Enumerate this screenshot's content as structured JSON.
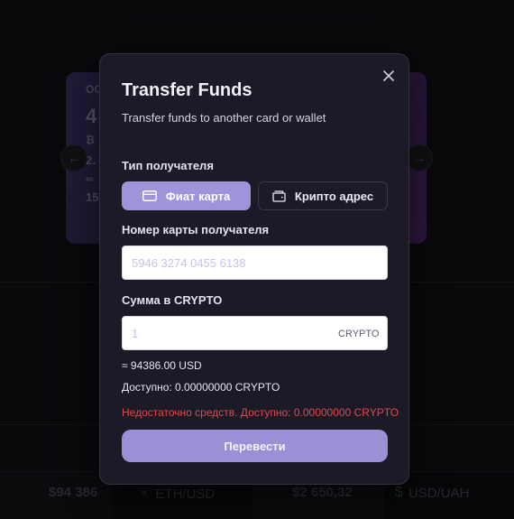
{
  "background": {
    "card": {
      "row1": "ОО",
      "row2": "4",
      "row3": "₿",
      "row4": "2.",
      "row5": "∞",
      "row6": "15"
    },
    "carousel": {
      "prev_icon": "arrow-left-icon",
      "next_icon": "arrow-right-icon"
    },
    "ticker": {
      "btc_price": "$94 386",
      "pair1_label": "ETH/USD",
      "pair1_icon": "eth-icon",
      "eth_price": "$2 650,32",
      "pair2_label": "USD/UAH",
      "pair2_icon": "dollar-icon"
    }
  },
  "modal": {
    "title": "Transfer Funds",
    "subtitle": "Transfer funds to another card or wallet",
    "close_icon": "close-icon",
    "recipient_type": {
      "label": "Тип получателя",
      "options": [
        {
          "label": "Фиат карта",
          "icon": "credit-card-icon",
          "selected": true
        },
        {
          "label": "Крипто адрес",
          "icon": "wallet-icon",
          "selected": false
        }
      ]
    },
    "card_number": {
      "label": "Номер карты получателя",
      "placeholder": "5946 3274 0455 6138",
      "value": ""
    },
    "amount": {
      "label": "Сумма в CRYPTO",
      "placeholder": "1",
      "value": "",
      "suffix": "CRYPTO"
    },
    "equivalent": "≈ 94386.00 USD",
    "available": "Доступно: 0.00000000 CRYPTO",
    "error": "Недостаточно средств. Доступно: 0.00000000 CRYPTO",
    "submit_label": "Перевести"
  },
  "colors": {
    "accent": "#9f93d9",
    "modal_bg": "#1c1a27",
    "error": "#e0474c"
  }
}
